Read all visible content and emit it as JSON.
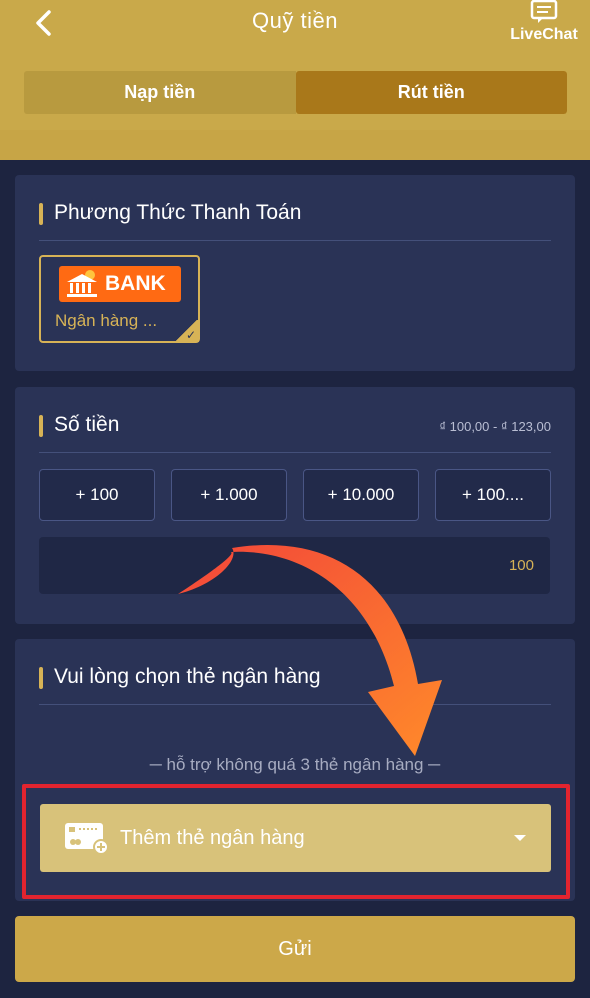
{
  "header": {
    "title": "Quỹ tiền",
    "livechat_label": "LiveChat",
    "tabs": [
      {
        "label": "Nạp tiền",
        "active": false
      },
      {
        "label": "Rút tiền",
        "active": true
      }
    ]
  },
  "payment": {
    "title": "Phương Thức Thanh Toán",
    "bank_logo_text": "BANK",
    "bank_name": "Ngân hàng ..."
  },
  "amount": {
    "title": "Số tiền",
    "range": "₫ 100,00 - ₫ 123,00",
    "quick_buttons": [
      "+ 100",
      "+ 1.000",
      "+ 10.000",
      "+ 100...."
    ],
    "input_value": "100"
  },
  "bank_card": {
    "title": "Vui lòng chọn thẻ ngân hàng",
    "support_note": "─ hỗ trợ không quá 3 thẻ ngân hàng ─",
    "add_label": "Thêm thẻ ngân hàng"
  },
  "submit_label": "Gửi",
  "colors": {
    "gold": "#c9a94a",
    "navy": "#1d2440",
    "card": "#2a3356",
    "accent": "#d7b356",
    "highlight": "#e2242f",
    "arrow": "#f4583a"
  }
}
